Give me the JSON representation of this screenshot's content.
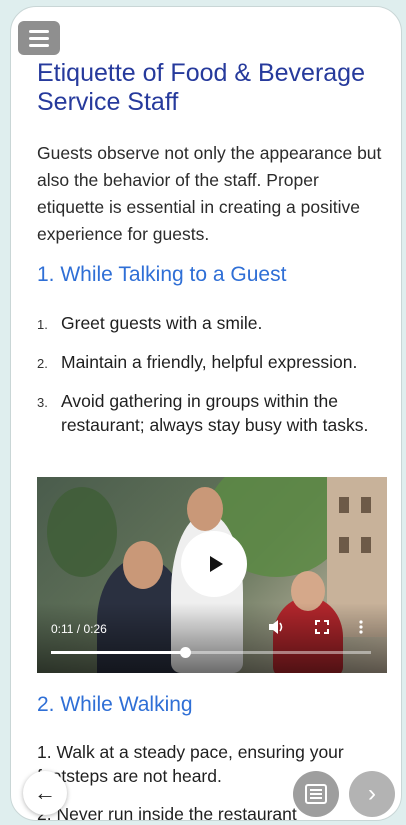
{
  "header": {
    "menu_icon": "hamburger-menu-icon"
  },
  "article": {
    "title": "Etiquette of Food & Beverage Service Staff",
    "intro": "Guests observe not only the appearance but also the behavior of the staff. Proper etiquette is essential in creating a positive experience for guests.",
    "section1": {
      "heading": "1. While Talking to a Guest",
      "items": [
        {
          "num": "1.",
          "text": "Greet guests with a smile."
        },
        {
          "num": "2.",
          "text": "Maintain a friendly, helpful expression."
        },
        {
          "num": "3.",
          "text": "Avoid gathering in groups within the restaurant; always stay busy with tasks."
        }
      ]
    },
    "video": {
      "time": "0:11 / 0:26",
      "progress_fraction": 0.42,
      "icons": [
        "play-icon",
        "volume-icon",
        "fullscreen-icon",
        "more-vert-icon"
      ]
    },
    "section2": {
      "heading": "2. While Walking",
      "items": [
        "1. Walk at a steady pace, ensuring your footsteps are not heard.",
        "2. Never run inside the restaurant"
      ]
    }
  },
  "nav": {
    "back_icon": "arrow-left-icon",
    "list_icon": "list-icon",
    "next_icon": "chevron-right-icon",
    "back_glyph": "←",
    "next_glyph": "›"
  },
  "colors": {
    "title": "#263a9c",
    "heading": "#2f6fd6",
    "menu_button": "#8f8f8f"
  }
}
